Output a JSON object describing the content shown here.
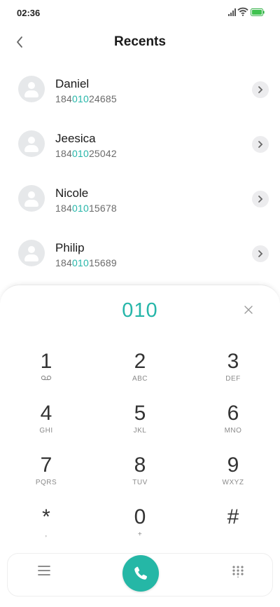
{
  "status": {
    "time": "02:36"
  },
  "header": {
    "title": "Recents"
  },
  "recents": [
    {
      "name": "Daniel",
      "number_pre": "184",
      "number_match": "010",
      "number_post": "24685"
    },
    {
      "name": "Jeesica",
      "number_pre": "184",
      "number_match": "010",
      "number_post": "25042"
    },
    {
      "name": "Nicole",
      "number_pre": "184",
      "number_match": "010",
      "number_post": "15678"
    },
    {
      "name": "Philip",
      "number_pre": "184",
      "number_match": "010",
      "number_post": "15689"
    }
  ],
  "dialpad": {
    "dialed": "010",
    "keys": [
      {
        "digit": "1",
        "letters": "voicemail-icon"
      },
      {
        "digit": "2",
        "letters": "ABC"
      },
      {
        "digit": "3",
        "letters": "DEF"
      },
      {
        "digit": "4",
        "letters": "GHI"
      },
      {
        "digit": "5",
        "letters": "JKL"
      },
      {
        "digit": "6",
        "letters": "MNO"
      },
      {
        "digit": "7",
        "letters": "PQRS"
      },
      {
        "digit": "8",
        "letters": "TUV"
      },
      {
        "digit": "9",
        "letters": "WXYZ"
      },
      {
        "digit": "*",
        "letters": ","
      },
      {
        "digit": "0",
        "letters": "+"
      },
      {
        "digit": "#",
        "letters": ""
      }
    ]
  },
  "colors": {
    "accent": "#26b6a9",
    "call_button": "#25b7a6"
  }
}
